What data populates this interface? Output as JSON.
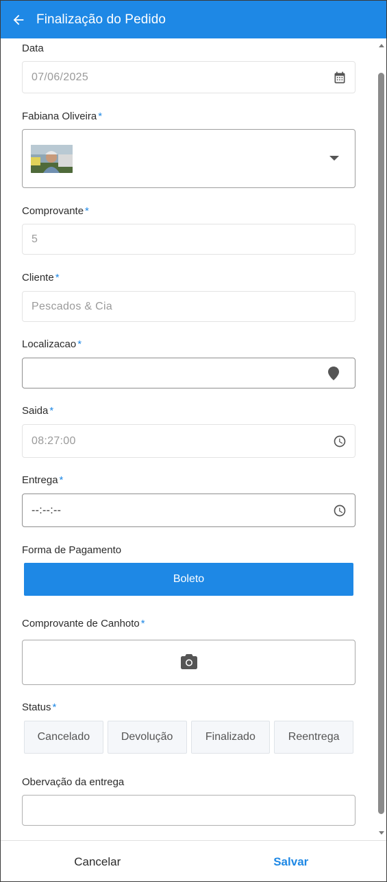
{
  "header": {
    "title": "Finalização do Pedido",
    "back_icon": "arrow-left-icon"
  },
  "form": {
    "date": {
      "label": "Data",
      "value": "07/06/2025",
      "icon": "calendar-icon"
    },
    "driver": {
      "label": "Fabiana Oliveira",
      "required_mark": "*",
      "icon": "caret-down-icon"
    },
    "receipt": {
      "label": "Comprovante",
      "required_mark": "*",
      "value": "5"
    },
    "client": {
      "label": "Cliente",
      "required_mark": "*",
      "value": "Pescados & Cia"
    },
    "location": {
      "label": "Localizacao",
      "required_mark": "*",
      "value": "",
      "icon": "map-pin-icon"
    },
    "departure": {
      "label": "Saida",
      "required_mark": "*",
      "value": "08:27:00",
      "icon": "clock-icon"
    },
    "delivery": {
      "label": "Entrega",
      "required_mark": "*",
      "value": "--:--:--",
      "icon": "clock-icon"
    },
    "payment": {
      "label": "Forma de Pagamento",
      "value": "Boleto"
    },
    "stub": {
      "label": "Comprovante de Canhoto",
      "required_mark": "*",
      "icon": "camera-icon"
    },
    "status": {
      "label": "Status",
      "required_mark": "*",
      "options": [
        "Cancelado",
        "Devolução",
        "Finalizado",
        "Reentrega"
      ]
    },
    "notes": {
      "label": "Obervação da entrega",
      "value": ""
    }
  },
  "footer": {
    "cancel_label": "Cancelar",
    "save_label": "Salvar"
  },
  "colors": {
    "primary": "#1e88e5",
    "icon_gray": "#555555"
  }
}
